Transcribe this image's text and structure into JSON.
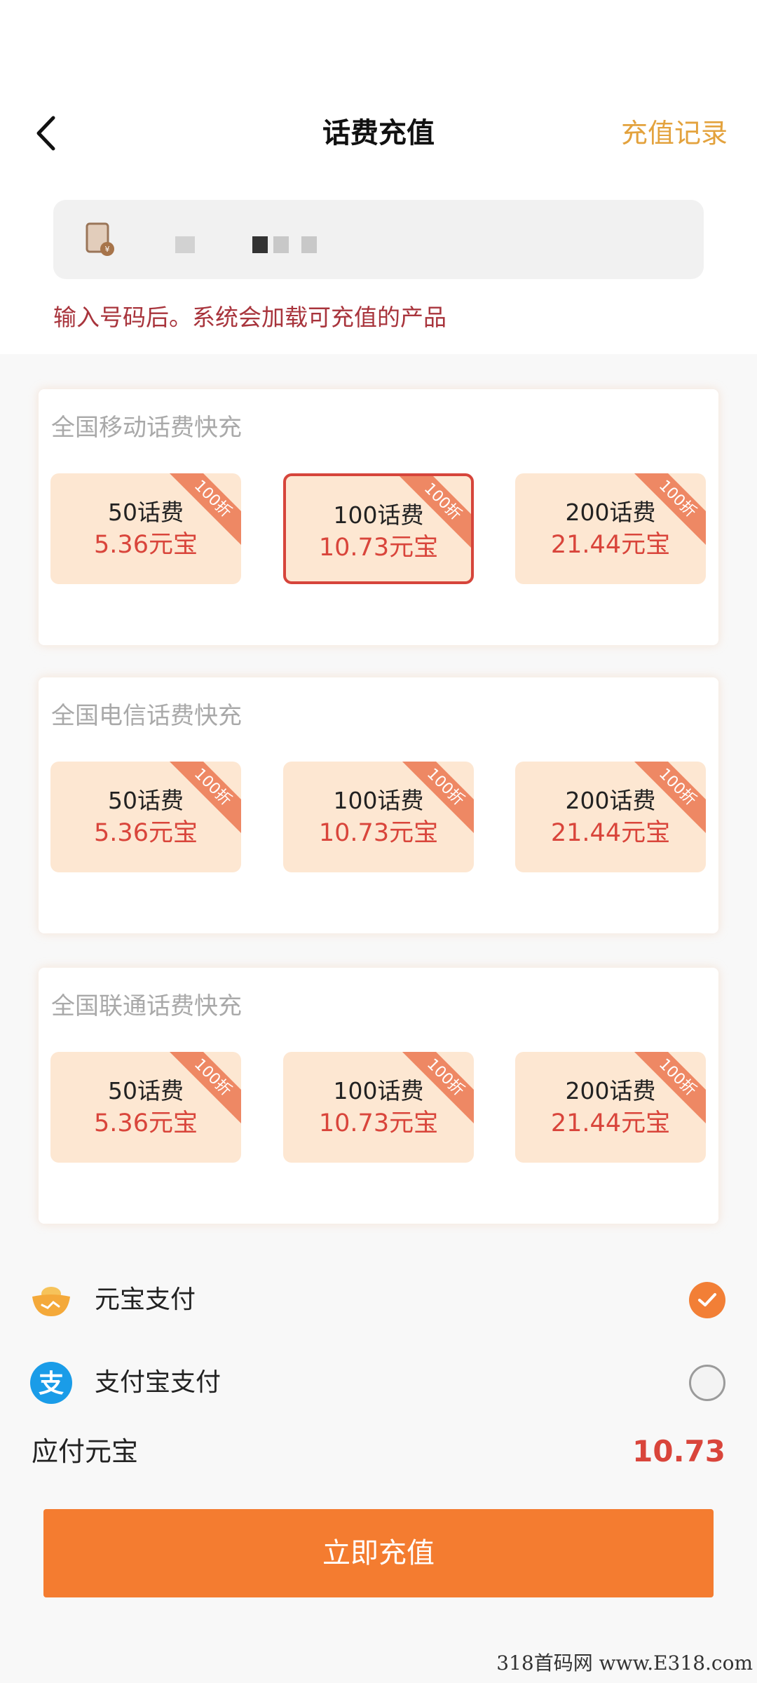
{
  "header": {
    "title": "话费充值",
    "record_link": "充值记录"
  },
  "phone": {
    "value": "",
    "hint": "输入号码后。系统会加载可充值的产品"
  },
  "sections": [
    {
      "title": "全国移动话费快充",
      "cards": [
        {
          "amount": "50话费",
          "price": "5.36元宝",
          "badge": "100折"
        },
        {
          "amount": "100话费",
          "price": "10.73元宝",
          "badge": "100折"
        },
        {
          "amount": "200话费",
          "price": "21.44元宝",
          "badge": "100折"
        }
      ]
    },
    {
      "title": "全国电信话费快充",
      "cards": [
        {
          "amount": "50话费",
          "price": "5.36元宝",
          "badge": "100折"
        },
        {
          "amount": "100话费",
          "price": "10.73元宝",
          "badge": "100折"
        },
        {
          "amount": "200话费",
          "price": "21.44元宝",
          "badge": "100折"
        }
      ]
    },
    {
      "title": "全国联通话费快充",
      "cards": [
        {
          "amount": "50话费",
          "price": "5.36元宝",
          "badge": "100折"
        },
        {
          "amount": "100话费",
          "price": "10.73元宝",
          "badge": "100折"
        },
        {
          "amount": "200话费",
          "price": "21.44元宝",
          "badge": "100折"
        }
      ]
    }
  ],
  "payment": {
    "options": [
      {
        "label": "元宝支付",
        "icon": "yuanbao-ingot-icon",
        "selected": true
      },
      {
        "label": "支付宝支付",
        "icon": "alipay-icon",
        "selected": false
      }
    ],
    "due_label": "应付元宝",
    "due_value": "10.73"
  },
  "submit_label": "立即充值",
  "watermark": "318首码网 www.E318.com",
  "colors": {
    "accent_orange": "#f47c30",
    "price_red": "#d9453b",
    "card_bg": "#fde7d2",
    "record_link": "#e3a23d",
    "hint_text": "#a8343c"
  }
}
